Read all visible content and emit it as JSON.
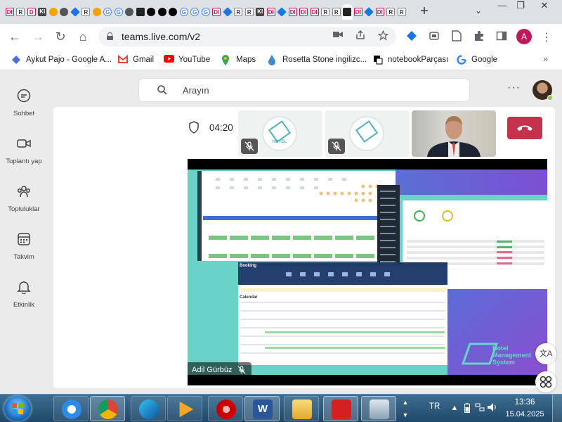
{
  "browser": {
    "tabs": [
      {
        "glyph": "DI",
        "kind": "d"
      },
      {
        "glyph": "R",
        "kind": "r"
      },
      {
        "glyph": "D",
        "kind": "d"
      },
      {
        "glyph": "KI",
        "kind": "k"
      },
      {
        "glyph": "",
        "kind": "o"
      },
      {
        "glyph": "",
        "kind": "c"
      },
      {
        "glyph": "",
        "kind": "b"
      },
      {
        "glyph": "R",
        "kind": "r"
      },
      {
        "glyph": "",
        "kind": "o"
      },
      {
        "glyph": "G",
        "kind": "g"
      },
      {
        "glyph": "G",
        "kind": "g"
      },
      {
        "glyph": "",
        "kind": "c"
      },
      {
        "glyph": "",
        "kind": "x"
      },
      {
        "glyph": "",
        "kind": "s"
      },
      {
        "glyph": "",
        "kind": "s"
      },
      {
        "glyph": "",
        "kind": "s"
      },
      {
        "glyph": "G",
        "kind": "g"
      },
      {
        "glyph": "G",
        "kind": "g"
      },
      {
        "glyph": "G",
        "kind": "g"
      },
      {
        "glyph": "DI",
        "kind": "d"
      },
      {
        "glyph": "",
        "kind": "b"
      },
      {
        "glyph": "R",
        "kind": "r"
      },
      {
        "glyph": "R",
        "kind": "r"
      },
      {
        "glyph": "KI",
        "kind": "k"
      },
      {
        "glyph": "DI",
        "kind": "d"
      },
      {
        "glyph": "",
        "kind": "b"
      },
      {
        "glyph": "DI",
        "kind": "d"
      },
      {
        "glyph": "DI",
        "kind": "d"
      },
      {
        "glyph": "DI",
        "kind": "d"
      },
      {
        "glyph": "R",
        "kind": "r"
      },
      {
        "glyph": "R",
        "kind": "r"
      },
      {
        "glyph": "",
        "kind": "x"
      },
      {
        "glyph": "DI",
        "kind": "d"
      },
      {
        "glyph": "",
        "kind": "b"
      },
      {
        "glyph": "DI",
        "kind": "d"
      },
      {
        "glyph": "R",
        "kind": "r"
      },
      {
        "glyph": "R",
        "kind": "r"
      }
    ],
    "active_tab_index": 31,
    "new_tab_glyph": "+",
    "tab_search_glyph": "⌄",
    "window": {
      "minimize": "—",
      "restore": "❐",
      "close": "✕"
    },
    "nav": {
      "back": "←",
      "forward": "→",
      "reload": "↻",
      "home": "⌂"
    },
    "url": "teams.live.com/v2",
    "omnibox_icons": [
      "camera-icon",
      "share-icon",
      "star-icon"
    ],
    "toolbar_icons": [
      "extension-icon",
      "office-icon",
      "page-icon",
      "puzzle-icon",
      "sidepanel-icon"
    ],
    "profile_initial": "A",
    "menu_glyph": "⋮",
    "bookmarks": [
      {
        "label": "Aykut Pajo - Google A...",
        "icon_color": "#4a6ee0"
      },
      {
        "label": "Gmail",
        "icon_color": "#ea4335"
      },
      {
        "label": "YouTube",
        "icon_color": "#ff0000"
      },
      {
        "label": "Maps",
        "icon_color": "#34a853"
      },
      {
        "label": "Rosetta Stone ingilizc...",
        "icon_color": "#3b8bd0"
      },
      {
        "label": "notebookParçası",
        "icon_color": "#000000"
      },
      {
        "label": "Google",
        "icon_color": "#4285f4"
      }
    ],
    "bookmarks_more": "»"
  },
  "teams": {
    "rail": [
      {
        "label": "Sohbet",
        "icon": "chat-icon"
      },
      {
        "label": "Toplantı yap",
        "icon": "video-camera-icon"
      },
      {
        "label": "Topluluklar",
        "icon": "communities-icon"
      },
      {
        "label": "Takvim",
        "icon": "calendar-icon"
      },
      {
        "label": "Etkinlik",
        "icon": "bell-icon"
      }
    ],
    "search_placeholder": "Arayın",
    "more_glyph": "···",
    "call": {
      "timer": "04:20",
      "presenter": "Adil Gürbüz",
      "hangup_color": "#c4314b",
      "tile_logo_text": "HOTEL"
    },
    "shared_screen": {
      "app_title": "Booking",
      "calendar_label": "Calendar",
      "brand_line1": "Hotel",
      "brand_line2": "Management",
      "brand_line3": "System",
      "brand_color": "#6ad3c8"
    },
    "floating": {
      "translate": "文A",
      "apps": "⚘"
    }
  },
  "taskbar": {
    "apps": [
      "ie-icon",
      "chrome-icon",
      "edge-icon",
      "media-player-icon",
      "security-icon",
      "word-icon",
      "explorer-icon",
      "acrobat-icon",
      "remote-desktop-icon"
    ],
    "language": "TR",
    "time": "13:36",
    "date": "15.04.2025"
  }
}
